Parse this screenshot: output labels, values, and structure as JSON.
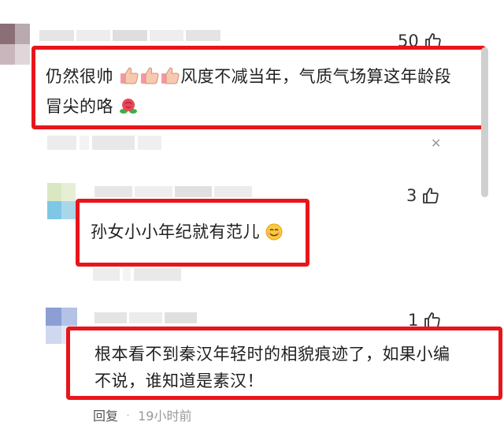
{
  "comments": [
    {
      "likes": "50",
      "text": "仍然很帅",
      "text_after_emoji": "风度不减当年，气质气场算这年龄段冒尖的咯"
    },
    {
      "likes": "3",
      "text": "孙女小小年纪就有范儿"
    },
    {
      "likes": "1",
      "text": "根本看不到秦汉年轻时的相貌痕迹了，如果小编不说，谁知道是素汉！",
      "reply_label": "回复",
      "separator": "·",
      "time": "19小时前"
    }
  ],
  "colors": {
    "highlight": "#e8151b",
    "scrollbar": "#cfcfcf"
  },
  "icons": [
    "thumbs-up-icon",
    "close-icon",
    "thumbs-up-emoji",
    "rose-emoji",
    "smile-emoji"
  ]
}
